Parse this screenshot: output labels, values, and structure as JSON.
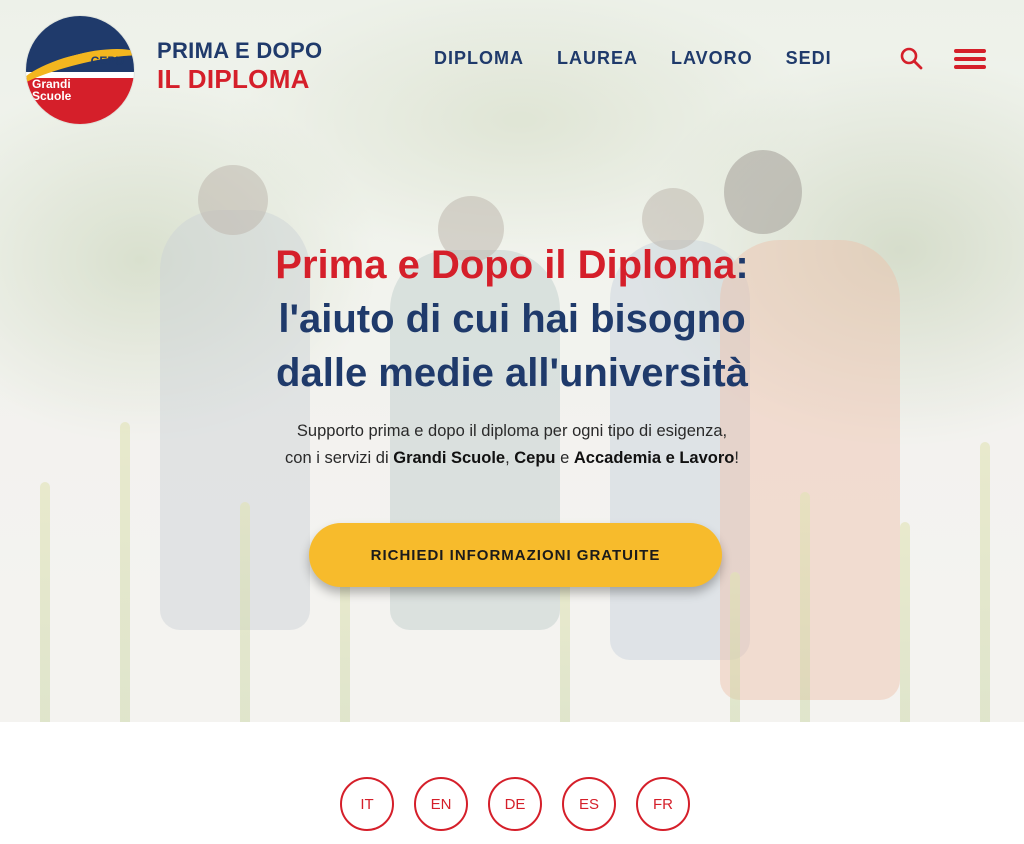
{
  "logo": {
    "top_text": "CEPU",
    "bottom_text": "Grandi Scuole"
  },
  "brand": {
    "line1": "PRIMA E DOPO",
    "line2": "IL DIPLOMA"
  },
  "nav": {
    "items": [
      "DIPLOMA",
      "LAUREA",
      "LAVORO",
      "SEDI"
    ]
  },
  "icons": {
    "search": "search-icon",
    "menu": "hamburger-menu-icon"
  },
  "hero": {
    "title_red": "Prima e Dopo il Diploma",
    "title_colon": ":",
    "title_line2": "l'aiuto di cui hai bisogno",
    "title_line3": "dalle medie all'università",
    "sub_line1": "Supporto prima e dopo il diploma per ogni tipo di esigenza,",
    "sub_pre": "con i servizi di ",
    "sub_b1": "Grandi Scuole",
    "sub_sep1": ", ",
    "sub_b2": "Cepu",
    "sub_sep2": " e ",
    "sub_b3": "Accademia e Lavoro",
    "sub_end": "!",
    "cta_label": "RICHIEDI INFORMAZIONI GRATUITE"
  },
  "languages": [
    "IT",
    "EN",
    "DE",
    "ES",
    "FR"
  ],
  "colors": {
    "navy": "#1f3a6b",
    "red": "#d51f2a",
    "yellow": "#f7bb2c"
  }
}
